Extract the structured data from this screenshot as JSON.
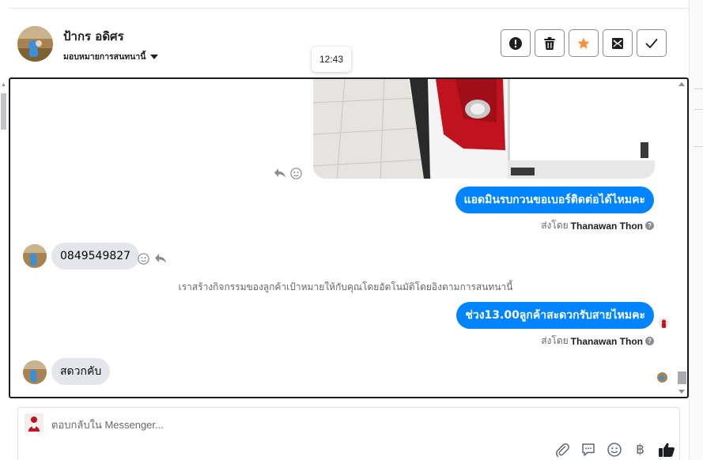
{
  "header": {
    "contact_name": "ป้ากร อดิศร",
    "assign_label": "มอบหมายการสนทนานี้",
    "time_tooltip": "12:43",
    "actions": [
      {
        "name": "report-spam",
        "icon": "alert-icon"
      },
      {
        "name": "delete",
        "icon": "trash-icon"
      },
      {
        "name": "follow-up",
        "icon": "star-icon",
        "color": "#f7923a"
      },
      {
        "name": "mark-unread",
        "icon": "envelope-icon"
      },
      {
        "name": "mark-done",
        "icon": "check-icon"
      }
    ]
  },
  "thread": {
    "messages": [
      {
        "type": "image",
        "direction": "out",
        "alt": "vehicle-photo"
      },
      {
        "type": "text",
        "direction": "out",
        "text": "แอดมินรบกวนขอเบอร์ติดต่อได้ไหมคะ"
      },
      {
        "type": "text",
        "direction": "in",
        "text": "0849549827"
      },
      {
        "type": "text",
        "direction": "out",
        "text": "ช่วง13.00ลูกค้าสะดวกรับสายไหมคะ"
      },
      {
        "type": "text",
        "direction": "in",
        "text": "สดวกคับ"
      }
    ],
    "sent_by_prefix": "ส่งโดย",
    "sent_by_name": "Thanawan Thon",
    "system_note": "เราสร้างกิจกรรมของลูกค้าเป้าหมายให้กับคุณโดยอัตโนมัติโดยอิงตามการสนทนานี้"
  },
  "composer": {
    "placeholder": "ตอบกลับใน Messenger...",
    "baht_symbol": "฿",
    "tools": [
      "paperclip-icon",
      "saved-reply-icon",
      "emoji-icon",
      "baht-icon",
      "thumbs-up-icon"
    ]
  },
  "colors": {
    "accent": "#0084ff",
    "incoming_bubble": "#e4e6eb",
    "star": "#f7923a",
    "text_secondary": "#65676b"
  }
}
